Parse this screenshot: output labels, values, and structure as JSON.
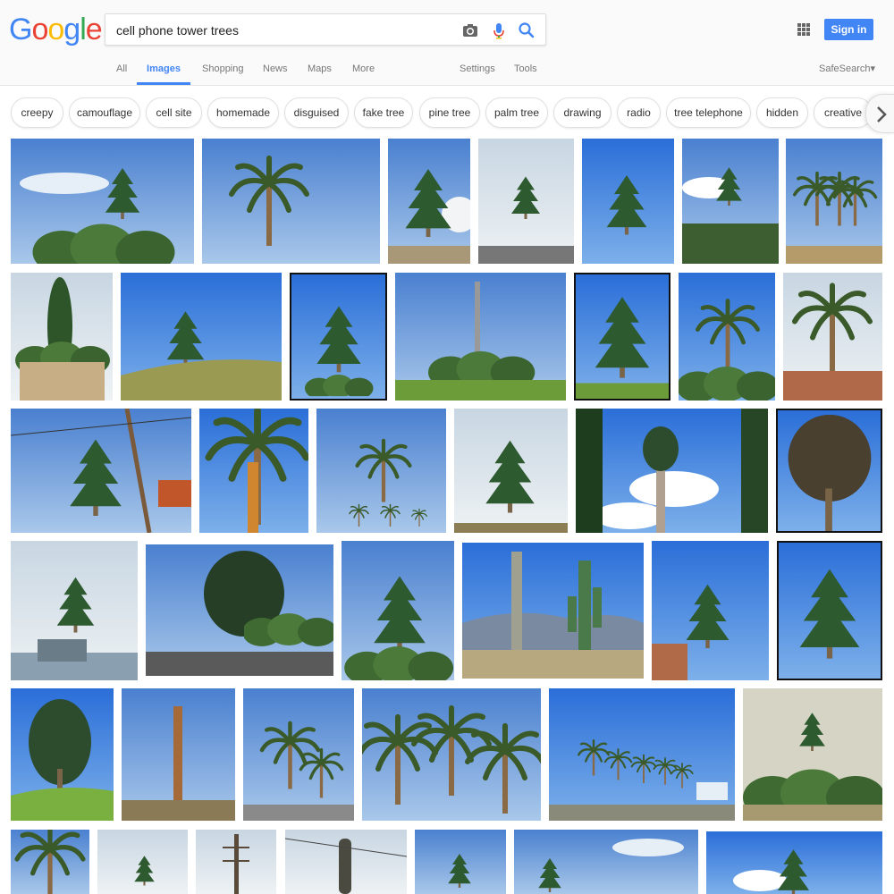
{
  "logo": {
    "letters": [
      "G",
      "o",
      "o",
      "g",
      "l",
      "e"
    ],
    "colors": [
      "#4285f4",
      "#ea4335",
      "#fbbc05",
      "#4285f4",
      "#34a853",
      "#ea4335"
    ]
  },
  "search": {
    "value": "cell phone tower trees"
  },
  "icons": {
    "camera": "camera-icon",
    "mic": "mic-icon",
    "search": "search-icon",
    "apps": "apps-grid-icon",
    "next": "chevron-right-icon"
  },
  "signin": {
    "label": "Sign in"
  },
  "tabs": [
    {
      "label": "All",
      "active": false
    },
    {
      "label": "Images",
      "active": true
    },
    {
      "label": "Shopping",
      "active": false
    },
    {
      "label": "News",
      "active": false
    },
    {
      "label": "Maps",
      "active": false
    },
    {
      "label": "More",
      "active": false
    }
  ],
  "tools": {
    "settings": "Settings",
    "tools": "Tools"
  },
  "safesearch": {
    "label": "SafeSearch",
    "caret": "▾"
  },
  "chips": [
    "creepy",
    "camouflage",
    "cell site",
    "homemade",
    "disguised",
    "fake tree",
    "pine tree",
    "palm tree",
    "drawing",
    "radio",
    "tree telephone",
    "hidden",
    "creative"
  ],
  "colors": {
    "accent": "#4285f4",
    "sky": "#5b8fd6",
    "tree": "#2f5a2f",
    "trunk": "#8a6a45"
  }
}
